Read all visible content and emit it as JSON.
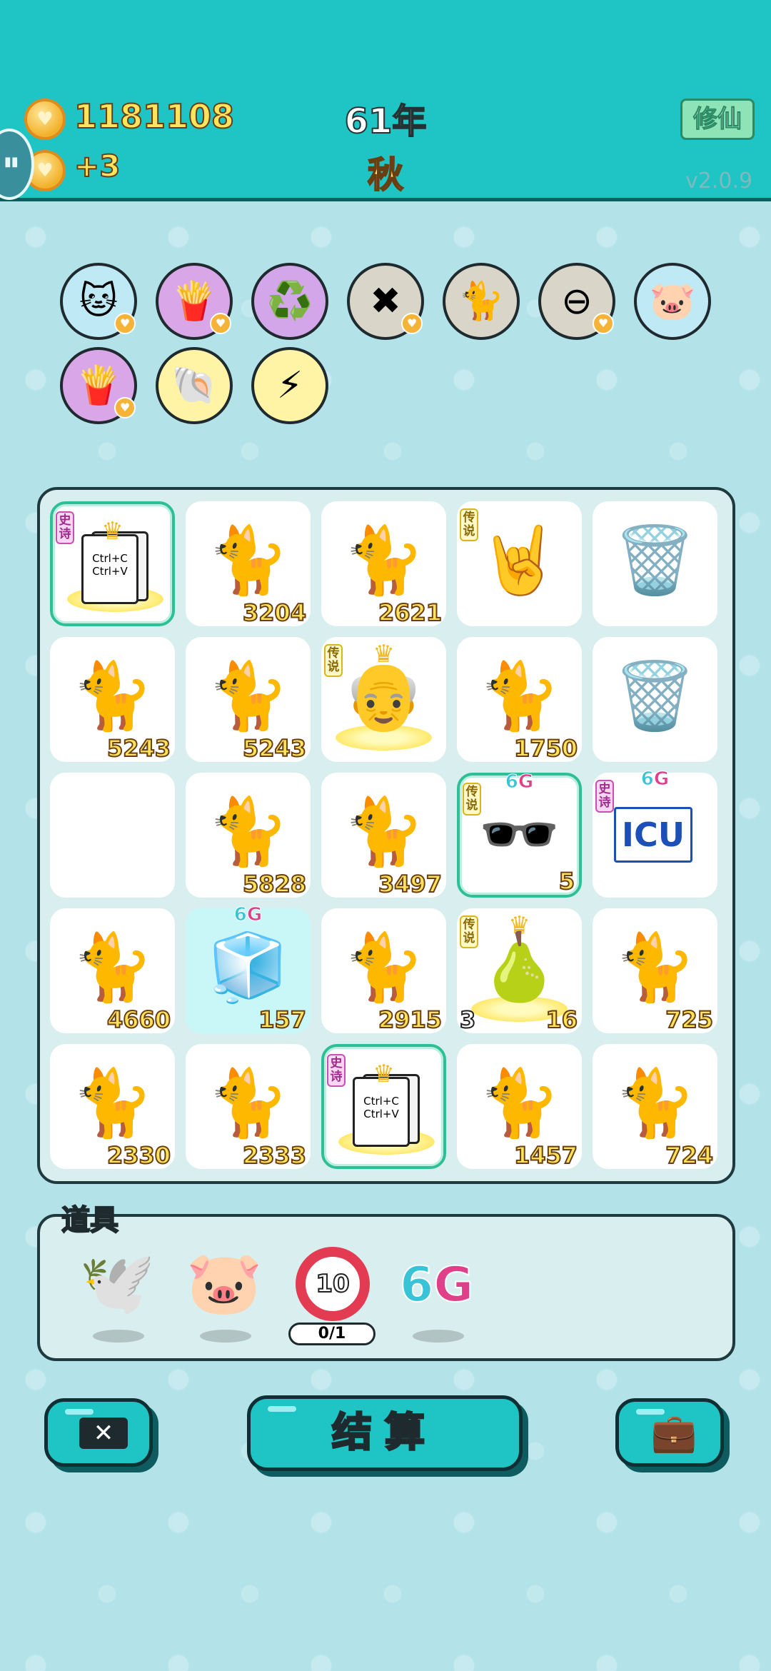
{
  "header": {
    "coins": "1181108",
    "income": "+3",
    "year": "61年",
    "season": "秋",
    "cultivate_button": "修仙",
    "version": "v2.0.9"
  },
  "buffs": [
    {
      "icon": "cat-ticket",
      "emoji": "🐱",
      "bg": "#bfe9f5",
      "heart": true
    },
    {
      "icon": "fries",
      "emoji": "🍟",
      "bg": "#d9a6e8",
      "heart": true
    },
    {
      "icon": "recycle",
      "emoji": "♻️",
      "bg": "#d2a6e8",
      "heart": false
    },
    {
      "icon": "delete-tag",
      "emoji": "✖",
      "bg": "#d9d5c9",
      "heart": true
    },
    {
      "icon": "twin-cats",
      "emoji": "🐈",
      "bg": "#d9d5c9",
      "heart": false
    },
    {
      "icon": "minus-circle",
      "emoji": "⊖",
      "bg": "#d9d5c9",
      "heart": true
    },
    {
      "icon": "piggy-bank",
      "emoji": "🐷",
      "bg": "#bfe9f5",
      "heart": false
    },
    {
      "icon": "fries",
      "emoji": "🍟",
      "bg": "#d9a6e8",
      "heart": true
    },
    {
      "icon": "shell",
      "emoji": "🐚",
      "bg": "#fff3a6",
      "heart": false
    },
    {
      "icon": "lightning",
      "emoji": "⚡",
      "bg": "#fff3a6",
      "heart": false
    }
  ],
  "board": [
    {
      "type": "copy-paste",
      "tag": "史诗",
      "tag_kind": "epic",
      "selected": true,
      "copy_line1": "Ctrl+C",
      "copy_line2": "Ctrl+V"
    },
    {
      "type": "cat",
      "num": "3204"
    },
    {
      "type": "cat",
      "num": "2621"
    },
    {
      "type": "hand",
      "tag": "传说",
      "tag_kind": "legend"
    },
    {
      "type": "trash-bag"
    },
    {
      "type": "cat",
      "num": "5243"
    },
    {
      "type": "cat",
      "num": "5243"
    },
    {
      "type": "old-man",
      "tag": "传说",
      "tag_kind": "legend"
    },
    {
      "type": "cat",
      "num": "1750"
    },
    {
      "type": "trash-bag"
    },
    {
      "type": "empty"
    },
    {
      "type": "cat",
      "num": "5828"
    },
    {
      "type": "cat",
      "num": "3497"
    },
    {
      "type": "psy",
      "tag": "传说",
      "tag_kind": "legend",
      "six_g": true,
      "selected": true,
      "num": "5"
    },
    {
      "type": "icu",
      "tag": "史诗",
      "tag_kind": "epic",
      "six_g": true,
      "label": "ICU"
    },
    {
      "type": "cat",
      "num": "4660"
    },
    {
      "type": "fridge",
      "six_g": true,
      "cyan": true,
      "num": "157"
    },
    {
      "type": "cat",
      "num": "2915"
    },
    {
      "type": "bag-crown",
      "tag": "传说",
      "tag_kind": "legend",
      "num": "16",
      "num_left": "3"
    },
    {
      "type": "cat",
      "num": "725"
    },
    {
      "type": "cat",
      "num": "2330"
    },
    {
      "type": "cat",
      "num": "2333"
    },
    {
      "type": "copy-paste",
      "tag": "史诗",
      "tag_kind": "epic",
      "selected": true,
      "copy_line1": "Ctrl+C",
      "copy_line2": "Ctrl+V"
    },
    {
      "type": "cat",
      "num": "1457"
    },
    {
      "type": "cat",
      "num": "724"
    }
  ],
  "items": {
    "label": "道具",
    "ring_value": "10",
    "ring_count": "0/1",
    "six_g_a": "6",
    "six_g_b": "G"
  },
  "six_g": {
    "a": "6",
    "b": "G"
  },
  "buttons": {
    "settle": "结算"
  },
  "colors": {
    "header": "#1fc4c4",
    "accent_yellow": "#ffe45c",
    "epic": "#c94fb2",
    "legend": "#d8b51f"
  }
}
